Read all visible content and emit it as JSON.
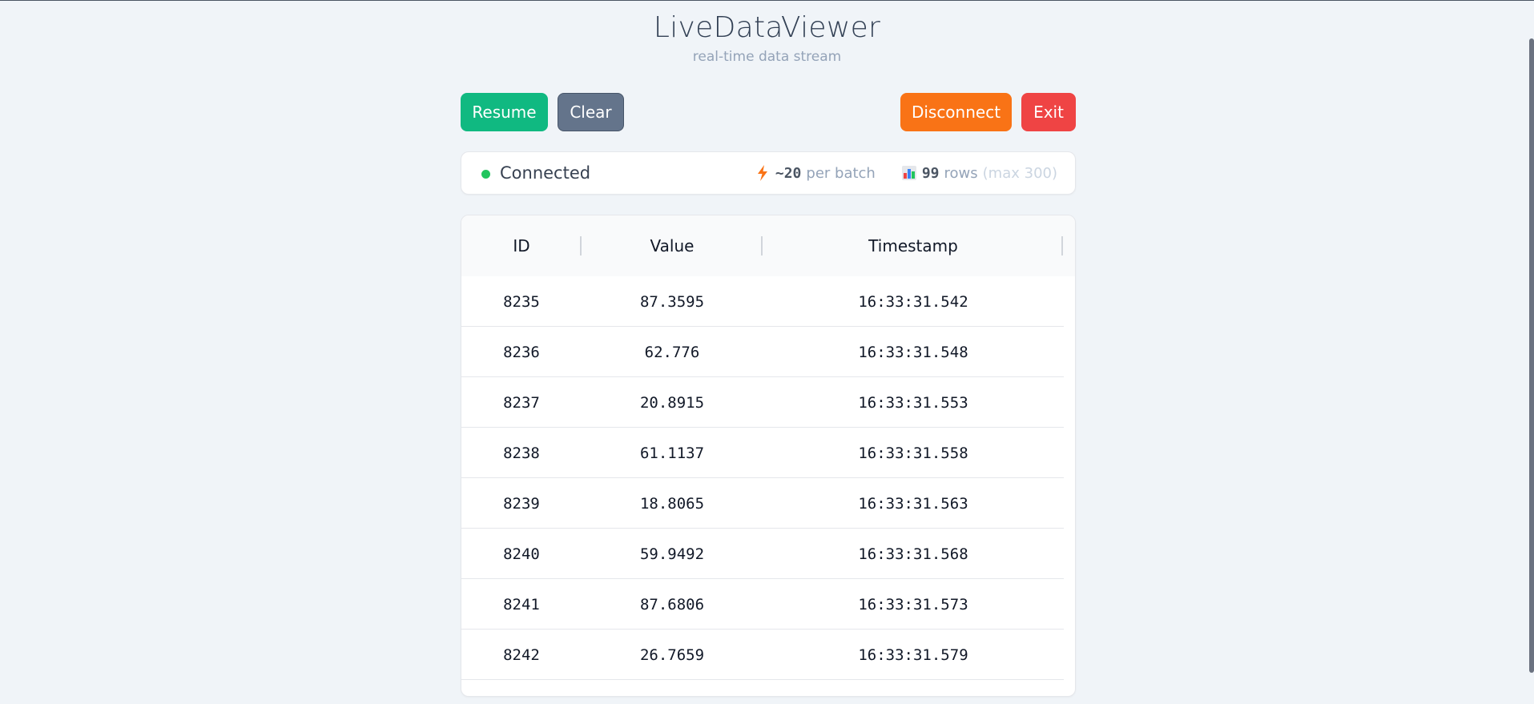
{
  "header": {
    "title": "LiveDataViewer",
    "subtitle": "real-time data stream"
  },
  "toolbar": {
    "resume_label": "Resume",
    "clear_label": "Clear",
    "disconnect_label": "Disconnect",
    "exit_label": "Exit"
  },
  "status": {
    "connection": "Connected",
    "batch_value": "~20",
    "batch_label": "per batch",
    "rows_value": "99",
    "rows_label": "rows",
    "max_label": "(max 300)"
  },
  "table": {
    "columns": [
      "ID",
      "Value",
      "Timestamp"
    ],
    "rows": [
      [
        "8235",
        "87.3595",
        "16:33:31.542"
      ],
      [
        "8236",
        "62.776",
        "16:33:31.548"
      ],
      [
        "8237",
        "20.8915",
        "16:33:31.553"
      ],
      [
        "8238",
        "61.1137",
        "16:33:31.558"
      ],
      [
        "8239",
        "18.8065",
        "16:33:31.563"
      ],
      [
        "8240",
        "59.9492",
        "16:33:31.568"
      ],
      [
        "8241",
        "87.6806",
        "16:33:31.573"
      ],
      [
        "8242",
        "26.7659",
        "16:33:31.579"
      ]
    ]
  },
  "colors": {
    "resume": "#10b981",
    "clear": "#64748b",
    "disconnect": "#f97316",
    "exit": "#ef4444",
    "connected": "#22c55e"
  },
  "icons": {
    "batch": "lightning-icon",
    "rows": "bar-chart-icon",
    "status": "status-dot-icon"
  }
}
